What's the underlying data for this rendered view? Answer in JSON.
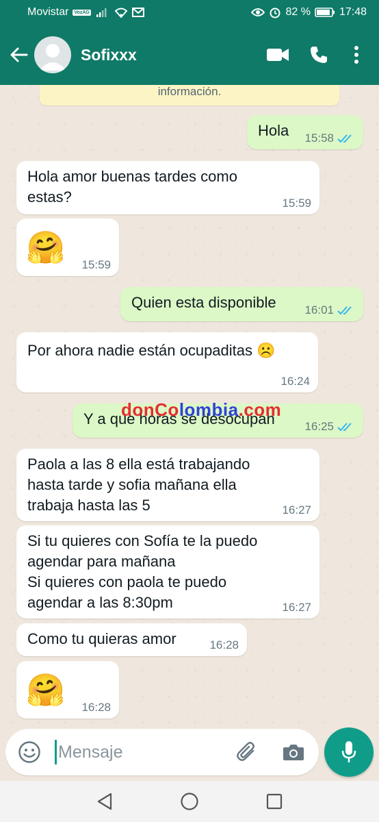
{
  "status_bar": {
    "carrier": "Movistar",
    "carrier_badge": "VozAG",
    "battery": "82 %",
    "time": "17:48"
  },
  "header": {
    "contact_name": "Sofixxx"
  },
  "system_note": "información.",
  "messages": [
    {
      "dir": "out",
      "text": "Hola",
      "time": "15:58",
      "ticks": "read"
    },
    {
      "dir": "in",
      "text": "Hola amor buenas tardes como\nestas?",
      "time": "15:59"
    },
    {
      "dir": "in",
      "text": "🤗",
      "time": "15:59",
      "emoji_only": true
    },
    {
      "dir": "out",
      "text": "Quien esta disponible",
      "time": "16:01",
      "ticks": "read"
    },
    {
      "dir": "in",
      "text": "Por ahora nadie están ocupaditas ☹️",
      "time": "16:24"
    },
    {
      "dir": "out",
      "text": "Y a que horas se desocupan",
      "time": "16:25",
      "ticks": "read"
    },
    {
      "dir": "in",
      "text": "Paola a las 8 ella está trabajando\nhasta tarde y sofia mañana ella\ntrabaja hasta las 5",
      "time": "16:27"
    },
    {
      "dir": "in",
      "text": "Si tu quieres con Sofía te la puedo\nagendar para mañana\nSi quieres con paola te puedo\nagendar a las 8:30pm",
      "time": "16:27"
    },
    {
      "dir": "in",
      "text": "Como tu quieras amor",
      "time": "16:28"
    },
    {
      "dir": "in",
      "text": "🤗",
      "time": "16:28",
      "emoji_only": true
    }
  ],
  "watermark": {
    "part1": "donCo",
    "part2": "lombia",
    "part3": ".com"
  },
  "composer": {
    "placeholder": "Mensaje"
  },
  "icons": {
    "back": "arrow-left-icon",
    "video": "video-call-icon",
    "call": "phone-icon",
    "menu": "more-vert-icon",
    "emoji": "emoji-icon",
    "attach": "paperclip-icon",
    "camera": "camera-icon",
    "mic": "microphone-icon",
    "read_ticks": "double-check-icon"
  },
  "colors": {
    "header": "#0f7a67",
    "outgoing_bubble": "#dcf8c6",
    "incoming_bubble": "#ffffff",
    "read_ticks": "#34b7f1",
    "mic_button": "#0f9d8a"
  }
}
